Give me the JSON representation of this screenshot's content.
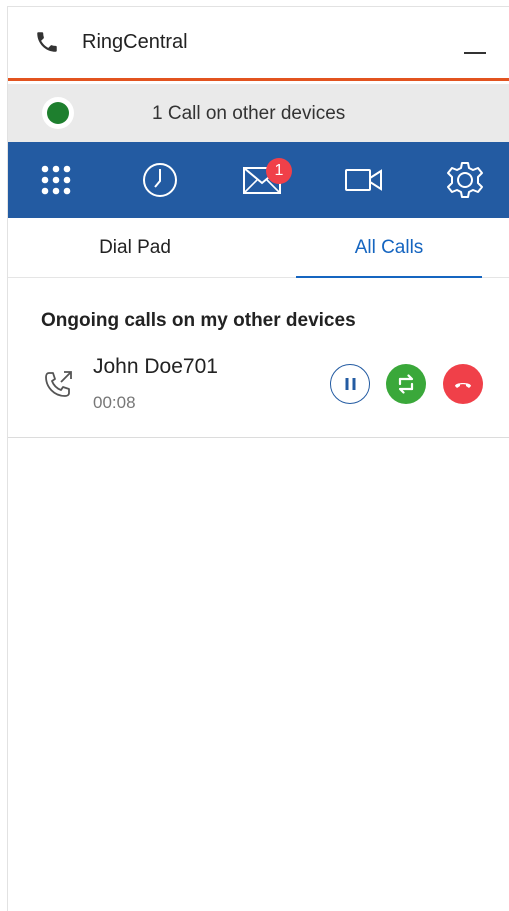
{
  "app": {
    "title": "RingCentral"
  },
  "status": {
    "text": "1 Call on other devices",
    "indicator_color": "#1e7f2e"
  },
  "toolbar": {
    "items": [
      {
        "name": "dialpad-icon"
      },
      {
        "name": "history-icon"
      },
      {
        "name": "messages-icon",
        "badge": "1"
      },
      {
        "name": "video-icon"
      },
      {
        "name": "settings-icon"
      }
    ],
    "background_color": "#235ba2"
  },
  "tabs": [
    {
      "label": "Dial Pad",
      "active": false
    },
    {
      "label": "All Calls",
      "active": true
    }
  ],
  "section": {
    "title": "Ongoing calls on my other devices"
  },
  "calls": [
    {
      "name": "John Doe701",
      "duration": "00:08"
    }
  ],
  "colors": {
    "accent": "#e2531f",
    "active_tab": "#1565c0",
    "hold": "#235ba2",
    "flip": "#3aa83a",
    "hangup": "#f04049"
  }
}
